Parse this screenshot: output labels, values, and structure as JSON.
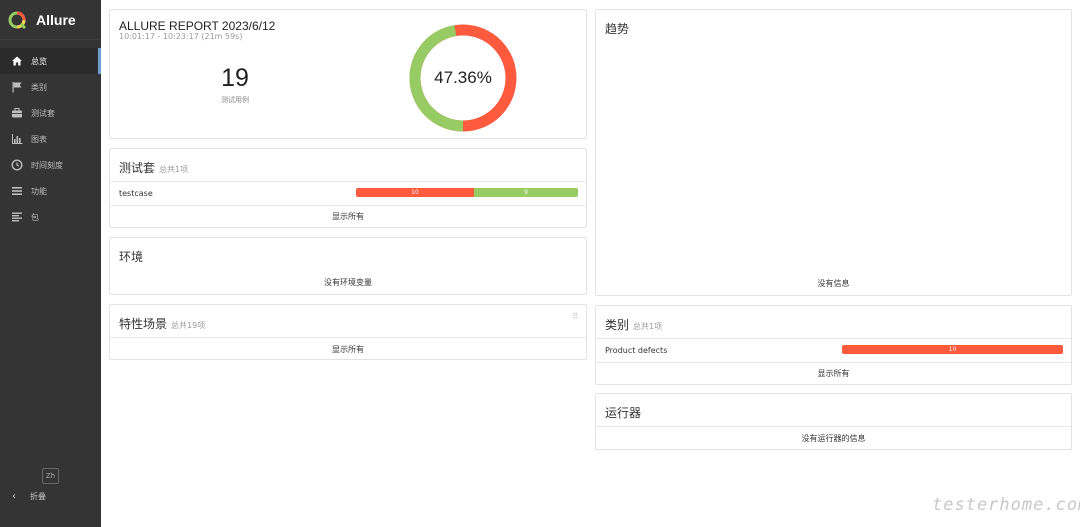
{
  "app": {
    "name": "Allure",
    "lang": "Zh",
    "collapse_label": "折叠"
  },
  "sidebar": {
    "items": [
      {
        "label": "总览",
        "icon": "home-icon",
        "active": true
      },
      {
        "label": "类别",
        "icon": "flag-icon",
        "active": false
      },
      {
        "label": "测试套",
        "icon": "briefcase-icon",
        "active": false
      },
      {
        "label": "图表",
        "icon": "bar-chart-icon",
        "active": false
      },
      {
        "label": "时间刻度",
        "icon": "clock-icon",
        "active": false
      },
      {
        "label": "功能",
        "icon": "list-icon",
        "active": false
      },
      {
        "label": "包",
        "icon": "align-left-icon",
        "active": false
      }
    ]
  },
  "summary": {
    "title": "ALLURE REPORT 2023/6/12",
    "time_range": "10:01:17 - 10:23:17 (21m 59s)",
    "count": "19",
    "count_label": "测试用例",
    "pass_percent": "47.36%",
    "pass_fraction": 0.4736
  },
  "suites": {
    "title": "测试套",
    "subtitle": "总共1项",
    "rows": [
      {
        "name": "testcase",
        "failed": "10",
        "passed": "9"
      }
    ],
    "show_all": "显示所有"
  },
  "environment": {
    "title": "环境",
    "empty": "没有环境变量"
  },
  "features": {
    "title": "特性场景",
    "subtitle": "总共19项",
    "show_all": "显示所有"
  },
  "trend": {
    "title": "趋势",
    "empty": "没有信息"
  },
  "categories": {
    "title": "类别",
    "subtitle": "总共1项",
    "rows": [
      {
        "name": "Product defects",
        "count": "10"
      }
    ],
    "show_all": "显示所有"
  },
  "executors": {
    "title": "运行器",
    "empty": "没有运行器的信息"
  },
  "watermark": "testerhome.com",
  "colors": {
    "failed": "#fd5a3e",
    "passed": "#97cc64",
    "sidebar_bg": "#343434",
    "accent": "#6f9fd0"
  }
}
